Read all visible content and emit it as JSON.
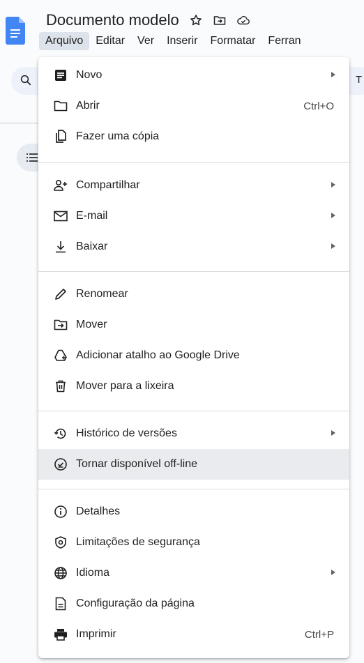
{
  "header": {
    "doc_title": "Documento modelo",
    "icons": [
      "star-icon",
      "move-folder-icon",
      "cloud-status-icon"
    ],
    "doc_icon_color": "#4285f4"
  },
  "menubar": {
    "items": [
      {
        "label": "Arquivo",
        "active": true
      },
      {
        "label": "Editar"
      },
      {
        "label": "Ver"
      },
      {
        "label": "Inserir"
      },
      {
        "label": "Formatar"
      },
      {
        "label": "Ferran"
      }
    ]
  },
  "toolbar": {
    "partial_text": "T"
  },
  "file_menu": {
    "groups": [
      [
        {
          "label": "Novo",
          "icon": "new-doc-icon",
          "submenu": true
        },
        {
          "label": "Abrir",
          "icon": "folder-open-icon",
          "shortcut": "Ctrl+O"
        },
        {
          "label": "Fazer uma cópia",
          "icon": "copy-icon"
        }
      ],
      [
        {
          "label": "Compartilhar",
          "icon": "share-person-icon",
          "submenu": true
        },
        {
          "label": "E-mail",
          "icon": "mail-icon",
          "submenu": true
        },
        {
          "label": "Baixar",
          "icon": "download-icon",
          "submenu": true
        }
      ],
      [
        {
          "label": "Renomear",
          "icon": "pencil-icon"
        },
        {
          "label": "Mover",
          "icon": "move-folder-icon"
        },
        {
          "label": "Adicionar atalho ao Google Drive",
          "icon": "drive-shortcut-icon"
        },
        {
          "label": "Mover para a lixeira",
          "icon": "trash-icon"
        }
      ],
      [
        {
          "label": "Histórico de versões",
          "icon": "history-icon",
          "submenu": true
        },
        {
          "label": "Tornar disponível off-line",
          "icon": "offline-icon",
          "highlighted": true
        }
      ],
      [
        {
          "label": "Detalhes",
          "icon": "info-icon"
        },
        {
          "label": "Limitações de segurança",
          "icon": "security-icon"
        },
        {
          "label": "Idioma",
          "icon": "globe-icon",
          "submenu": true
        },
        {
          "label": "Configuração da página",
          "icon": "page-setup-icon"
        },
        {
          "label": "Imprimir",
          "icon": "print-icon",
          "shortcut": "Ctrl+P"
        }
      ]
    ]
  },
  "colors": {
    "menu_bg": "#ffffff",
    "highlight_bg": "#e9ebee",
    "active_menubar_bg": "#dde3ea",
    "page_bg": "#f9fbfd"
  }
}
